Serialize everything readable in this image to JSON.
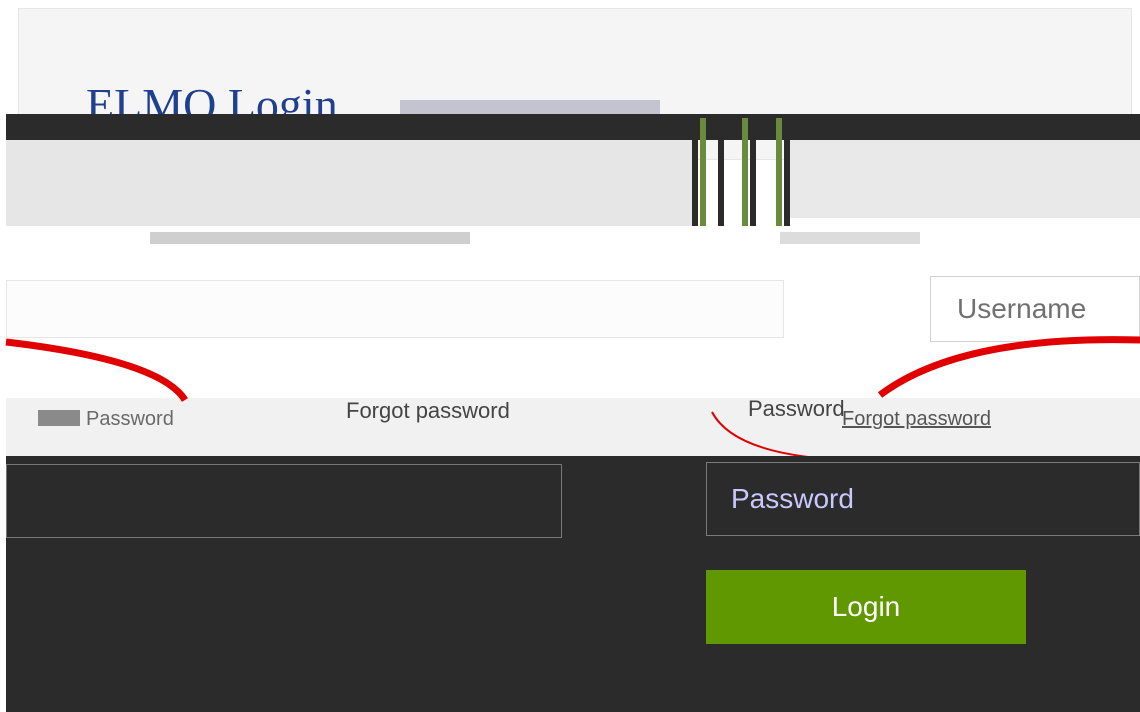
{
  "page": {
    "title": "ELMO Login"
  },
  "form": {
    "username_placeholder": "Username",
    "password_label": "Password",
    "password_placeholder": "Password",
    "forgot_password": "Forgot password",
    "login_button": "Login"
  },
  "colors": {
    "title_blue": "#1f3f8f",
    "dark_bg": "#2b2b2b",
    "login_green": "#5f9800",
    "annotation_red": "#e10000"
  }
}
